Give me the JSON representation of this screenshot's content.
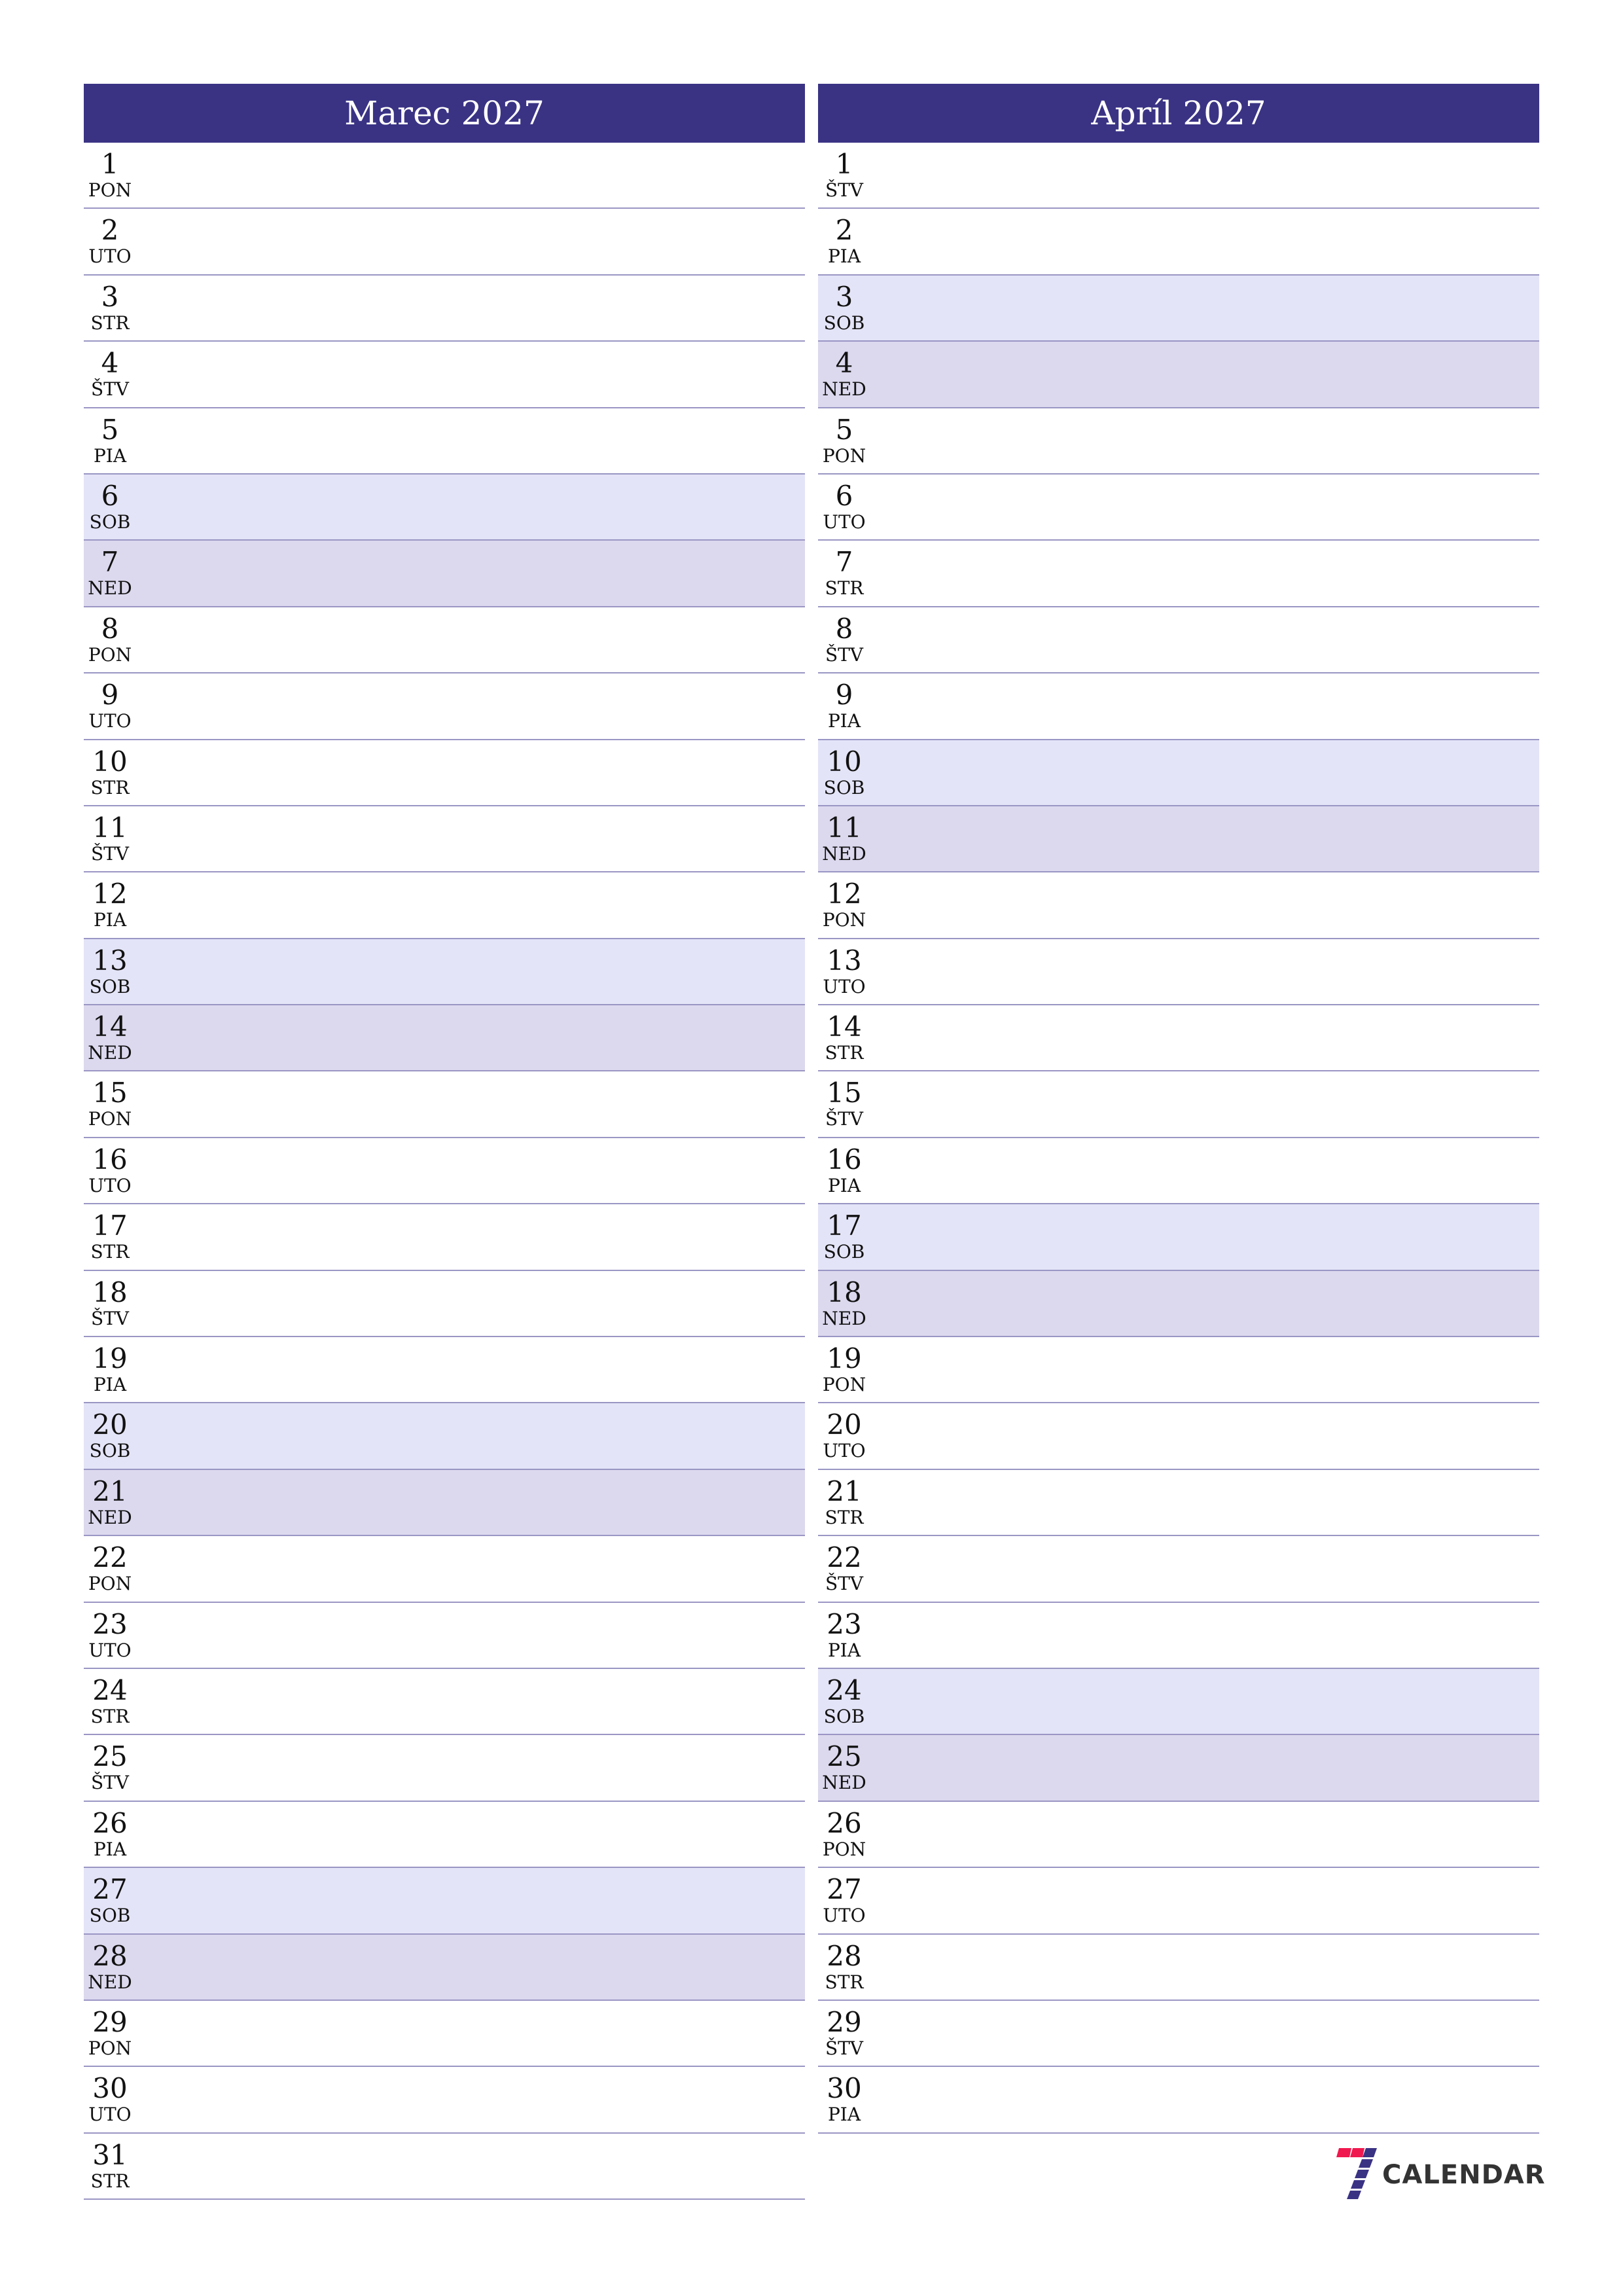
{
  "colors": {
    "header_bg": "#3A3384",
    "saturday_bg": "#E4E4F8",
    "sunday_bg": "#DCD8EE",
    "divider": "#9A96C4",
    "logo_red": "#F0194F",
    "logo_blue": "#3A3384",
    "logo_text": "#333333"
  },
  "months": [
    {
      "title": "Marec 2027",
      "days": [
        {
          "num": "1",
          "name": "PON",
          "type": "weekday"
        },
        {
          "num": "2",
          "name": "UTO",
          "type": "weekday"
        },
        {
          "num": "3",
          "name": "STR",
          "type": "weekday"
        },
        {
          "num": "4",
          "name": "ŠTV",
          "type": "weekday"
        },
        {
          "num": "5",
          "name": "PIA",
          "type": "weekday"
        },
        {
          "num": "6",
          "name": "SOB",
          "type": "sat"
        },
        {
          "num": "7",
          "name": "NED",
          "type": "sun"
        },
        {
          "num": "8",
          "name": "PON",
          "type": "weekday"
        },
        {
          "num": "9",
          "name": "UTO",
          "type": "weekday"
        },
        {
          "num": "10",
          "name": "STR",
          "type": "weekday"
        },
        {
          "num": "11",
          "name": "ŠTV",
          "type": "weekday"
        },
        {
          "num": "12",
          "name": "PIA",
          "type": "weekday"
        },
        {
          "num": "13",
          "name": "SOB",
          "type": "sat"
        },
        {
          "num": "14",
          "name": "NED",
          "type": "sun"
        },
        {
          "num": "15",
          "name": "PON",
          "type": "weekday"
        },
        {
          "num": "16",
          "name": "UTO",
          "type": "weekday"
        },
        {
          "num": "17",
          "name": "STR",
          "type": "weekday"
        },
        {
          "num": "18",
          "name": "ŠTV",
          "type": "weekday"
        },
        {
          "num": "19",
          "name": "PIA",
          "type": "weekday"
        },
        {
          "num": "20",
          "name": "SOB",
          "type": "sat"
        },
        {
          "num": "21",
          "name": "NED",
          "type": "sun"
        },
        {
          "num": "22",
          "name": "PON",
          "type": "weekday"
        },
        {
          "num": "23",
          "name": "UTO",
          "type": "weekday"
        },
        {
          "num": "24",
          "name": "STR",
          "type": "weekday"
        },
        {
          "num": "25",
          "name": "ŠTV",
          "type": "weekday"
        },
        {
          "num": "26",
          "name": "PIA",
          "type": "weekday"
        },
        {
          "num": "27",
          "name": "SOB",
          "type": "sat"
        },
        {
          "num": "28",
          "name": "NED",
          "type": "sun"
        },
        {
          "num": "29",
          "name": "PON",
          "type": "weekday"
        },
        {
          "num": "30",
          "name": "UTO",
          "type": "weekday"
        },
        {
          "num": "31",
          "name": "STR",
          "type": "weekday"
        }
      ]
    },
    {
      "title": "Apríl 2027",
      "days": [
        {
          "num": "1",
          "name": "ŠTV",
          "type": "weekday"
        },
        {
          "num": "2",
          "name": "PIA",
          "type": "weekday"
        },
        {
          "num": "3",
          "name": "SOB",
          "type": "sat"
        },
        {
          "num": "4",
          "name": "NED",
          "type": "sun"
        },
        {
          "num": "5",
          "name": "PON",
          "type": "weekday"
        },
        {
          "num": "6",
          "name": "UTO",
          "type": "weekday"
        },
        {
          "num": "7",
          "name": "STR",
          "type": "weekday"
        },
        {
          "num": "8",
          "name": "ŠTV",
          "type": "weekday"
        },
        {
          "num": "9",
          "name": "PIA",
          "type": "weekday"
        },
        {
          "num": "10",
          "name": "SOB",
          "type": "sat"
        },
        {
          "num": "11",
          "name": "NED",
          "type": "sun"
        },
        {
          "num": "12",
          "name": "PON",
          "type": "weekday"
        },
        {
          "num": "13",
          "name": "UTO",
          "type": "weekday"
        },
        {
          "num": "14",
          "name": "STR",
          "type": "weekday"
        },
        {
          "num": "15",
          "name": "ŠTV",
          "type": "weekday"
        },
        {
          "num": "16",
          "name": "PIA",
          "type": "weekday"
        },
        {
          "num": "17",
          "name": "SOB",
          "type": "sat"
        },
        {
          "num": "18",
          "name": "NED",
          "type": "sun"
        },
        {
          "num": "19",
          "name": "PON",
          "type": "weekday"
        },
        {
          "num": "20",
          "name": "UTO",
          "type": "weekday"
        },
        {
          "num": "21",
          "name": "STR",
          "type": "weekday"
        },
        {
          "num": "22",
          "name": "ŠTV",
          "type": "weekday"
        },
        {
          "num": "23",
          "name": "PIA",
          "type": "weekday"
        },
        {
          "num": "24",
          "name": "SOB",
          "type": "sat"
        },
        {
          "num": "25",
          "name": "NED",
          "type": "sun"
        },
        {
          "num": "26",
          "name": "PON",
          "type": "weekday"
        },
        {
          "num": "27",
          "name": "UTO",
          "type": "weekday"
        },
        {
          "num": "28",
          "name": "STR",
          "type": "weekday"
        },
        {
          "num": "29",
          "name": "ŠTV",
          "type": "weekday"
        },
        {
          "num": "30",
          "name": "PIA",
          "type": "weekday"
        }
      ]
    }
  ],
  "logo": {
    "icon": "seven-stripes-logo-icon",
    "text": "CALENDAR"
  }
}
